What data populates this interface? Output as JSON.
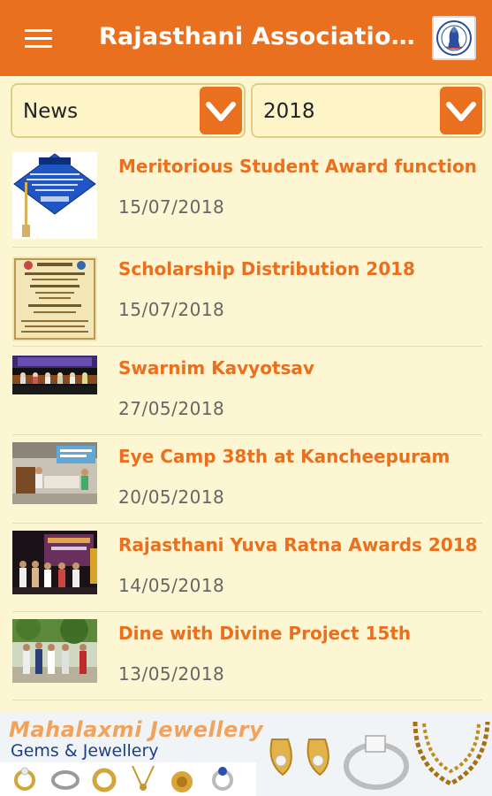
{
  "app_bar": {
    "title": "Rajasthani Association…",
    "menu_icon": "hamburger-menu-icon",
    "logo": "association-logo"
  },
  "filters": {
    "category": "News",
    "year": "2018",
    "dropdown_icon": "chevron-down-icon"
  },
  "news": [
    {
      "title": "Meritorious Student Award function",
      "date": "15/07/2018",
      "thumb": "graduation-cap-image"
    },
    {
      "title": "Scholarship Distribution 2018",
      "date": "15/07/2018",
      "thumb": "invitation-card-image"
    },
    {
      "title": "Swarnim Kavyotsav",
      "date": "27/05/2018",
      "thumb": "stage-event-image"
    },
    {
      "title": "Eye Camp 38th at Kancheepuram",
      "date": "20/05/2018",
      "thumb": "eye-camp-image"
    },
    {
      "title": "Rajasthani Yuva Ratna Awards 2018",
      "date": "14/05/2018",
      "thumb": "awards-stage-image"
    },
    {
      "title": "Dine with Divine Project 15th",
      "date": "13/05/2018",
      "thumb": "outdoor-group-image"
    }
  ],
  "ad": {
    "brand": "Mahalaxmi Jewellery",
    "tagline": "Gems & Jewellery"
  },
  "colors": {
    "primary": "#e8701f",
    "background": "#fdf6d3",
    "date_text": "#666666"
  }
}
